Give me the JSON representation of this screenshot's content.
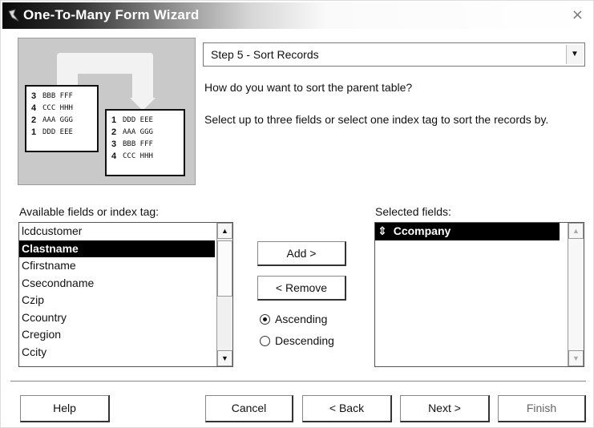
{
  "window": {
    "title": "One-To-Many Form Wizard",
    "close_glyph": "×"
  },
  "illustration": {
    "left_card": [
      {
        "num": "3",
        "code": "BBB FFF"
      },
      {
        "num": "4",
        "code": "CCC HHH"
      },
      {
        "num": "2",
        "code": "AAA GGG"
      },
      {
        "num": "1",
        "code": "DDD EEE"
      }
    ],
    "right_card": [
      {
        "num": "1",
        "code": "DDD EEE"
      },
      {
        "num": "2",
        "code": "AAA GGG"
      },
      {
        "num": "3",
        "code": "BBB FFF"
      },
      {
        "num": "4",
        "code": "CCC HHH"
      }
    ]
  },
  "step": {
    "value": "Step 5 - Sort Records"
  },
  "prompt": "How do you want to sort the parent table?",
  "instruction": "Select up to three fields or select one index tag to sort the records by.",
  "available": {
    "label": "Available fields or index tag:",
    "items": [
      "lcdcustomer",
      "Clastname",
      "Cfirstname",
      "Csecondname",
      "Czip",
      "Ccountry",
      "Cregion",
      "Ccity"
    ],
    "selected_index": 1
  },
  "buttons": {
    "add": "Add >",
    "remove": "< Remove",
    "help": "Help",
    "cancel": "Cancel",
    "back": "< Back",
    "next": "Next >",
    "finish": "Finish"
  },
  "order": {
    "ascending": "Ascending",
    "descending": "Descending",
    "selected": "ascending"
  },
  "selected_fields": {
    "label": "Selected fields:",
    "items": [
      "Ccompany"
    ],
    "mover_glyph": "⇕"
  },
  "icons": {
    "scroll_up": "▲",
    "scroll_down": "▼",
    "dropdown": "▼"
  }
}
